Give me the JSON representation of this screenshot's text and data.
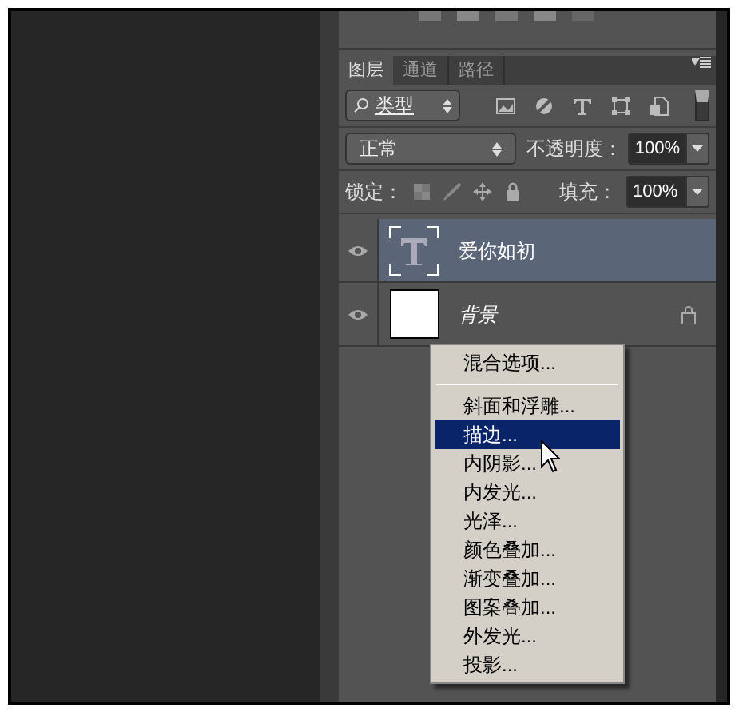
{
  "tabs": [
    {
      "label": "图层",
      "selected": true
    },
    {
      "label": "通道",
      "selected": false
    },
    {
      "label": "路径",
      "selected": false
    }
  ],
  "filter": {
    "value": "类型"
  },
  "blend": {
    "value": "正常",
    "opacity_label": "不透明度：",
    "opacity": "100%"
  },
  "lock": {
    "label": "锁定：",
    "fill_label": "填充：",
    "fill": "100%"
  },
  "layers": [
    {
      "name": "爱你如初",
      "kind": "text",
      "selected": true,
      "visible": true,
      "locked": false
    },
    {
      "name": "背景",
      "kind": "image",
      "selected": false,
      "visible": true,
      "locked": true
    }
  ],
  "context_menu": {
    "groups": [
      [
        {
          "label": "混合选项...",
          "selected": false
        }
      ],
      [
        {
          "label": "斜面和浮雕...",
          "selected": false
        },
        {
          "label": "描边...",
          "selected": true
        },
        {
          "label": "内阴影...",
          "selected": false
        },
        {
          "label": "内发光...",
          "selected": false
        },
        {
          "label": "光泽...",
          "selected": false
        },
        {
          "label": "颜色叠加...",
          "selected": false
        },
        {
          "label": "渐变叠加...",
          "selected": false
        },
        {
          "label": "图案叠加...",
          "selected": false
        },
        {
          "label": "外发光...",
          "selected": false
        },
        {
          "label": "投影...",
          "selected": false
        }
      ]
    ]
  }
}
